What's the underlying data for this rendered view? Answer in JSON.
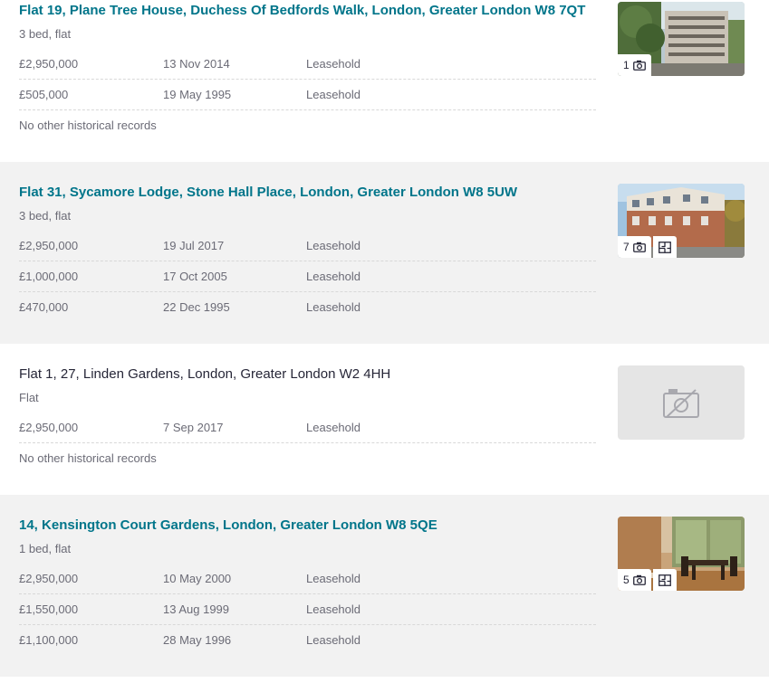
{
  "listings": [
    {
      "address": "Flat 19, Plane Tree House, Duchess Of Bedfords Walk, London, Greater London W8 7QT",
      "details": "3 bed, flat",
      "sales": [
        {
          "price": "£2,950,000",
          "date": "13 Nov 2014",
          "tenure": "Leasehold"
        },
        {
          "price": "£505,000",
          "date": "19 May 1995",
          "tenure": "Leasehold"
        }
      ],
      "note": "No other historical records",
      "photo_count": "1",
      "thumb_icon": "camera-icon"
    },
    {
      "address": "Flat 31, Sycamore Lodge, Stone Hall Place, London, Greater London W8 5UW",
      "details": "3 bed, flat",
      "sales": [
        {
          "price": "£2,950,000",
          "date": "19 Jul 2017",
          "tenure": "Leasehold"
        },
        {
          "price": "£1,000,000",
          "date": "17 Oct 2005",
          "tenure": "Leasehold"
        },
        {
          "price": "£470,000",
          "date": "22 Dec 1995",
          "tenure": "Leasehold"
        }
      ],
      "photo_count": "7",
      "thumb_icon": "camera-icon",
      "floorplan_icon": "floorplan-icon"
    },
    {
      "address": "Flat 1, 27, Linden Gardens, London, Greater London W2 4HH",
      "details": "Flat",
      "sales": [
        {
          "price": "£2,950,000",
          "date": "7 Sep 2017",
          "tenure": "Leasehold"
        }
      ],
      "note": "No other historical records",
      "thumb_icon": "no-photo-icon"
    },
    {
      "address": "14, Kensington Court Gardens, London, Greater London W8 5QE",
      "details": "1 bed, flat",
      "sales": [
        {
          "price": "£2,950,000",
          "date": "10 May 2000",
          "tenure": "Leasehold"
        },
        {
          "price": "£1,550,000",
          "date": "13 Aug 1999",
          "tenure": "Leasehold"
        },
        {
          "price": "£1,100,000",
          "date": "28 May 1996",
          "tenure": "Leasehold"
        }
      ],
      "photo_count": "5",
      "thumb_icon": "camera-icon",
      "floorplan_icon": "floorplan-icon"
    }
  ],
  "colors": {
    "link": "#00758a",
    "muted_text": "#6b6b76",
    "card_shade": "#f2f2f2",
    "placeholder": "#e5e5e5"
  }
}
